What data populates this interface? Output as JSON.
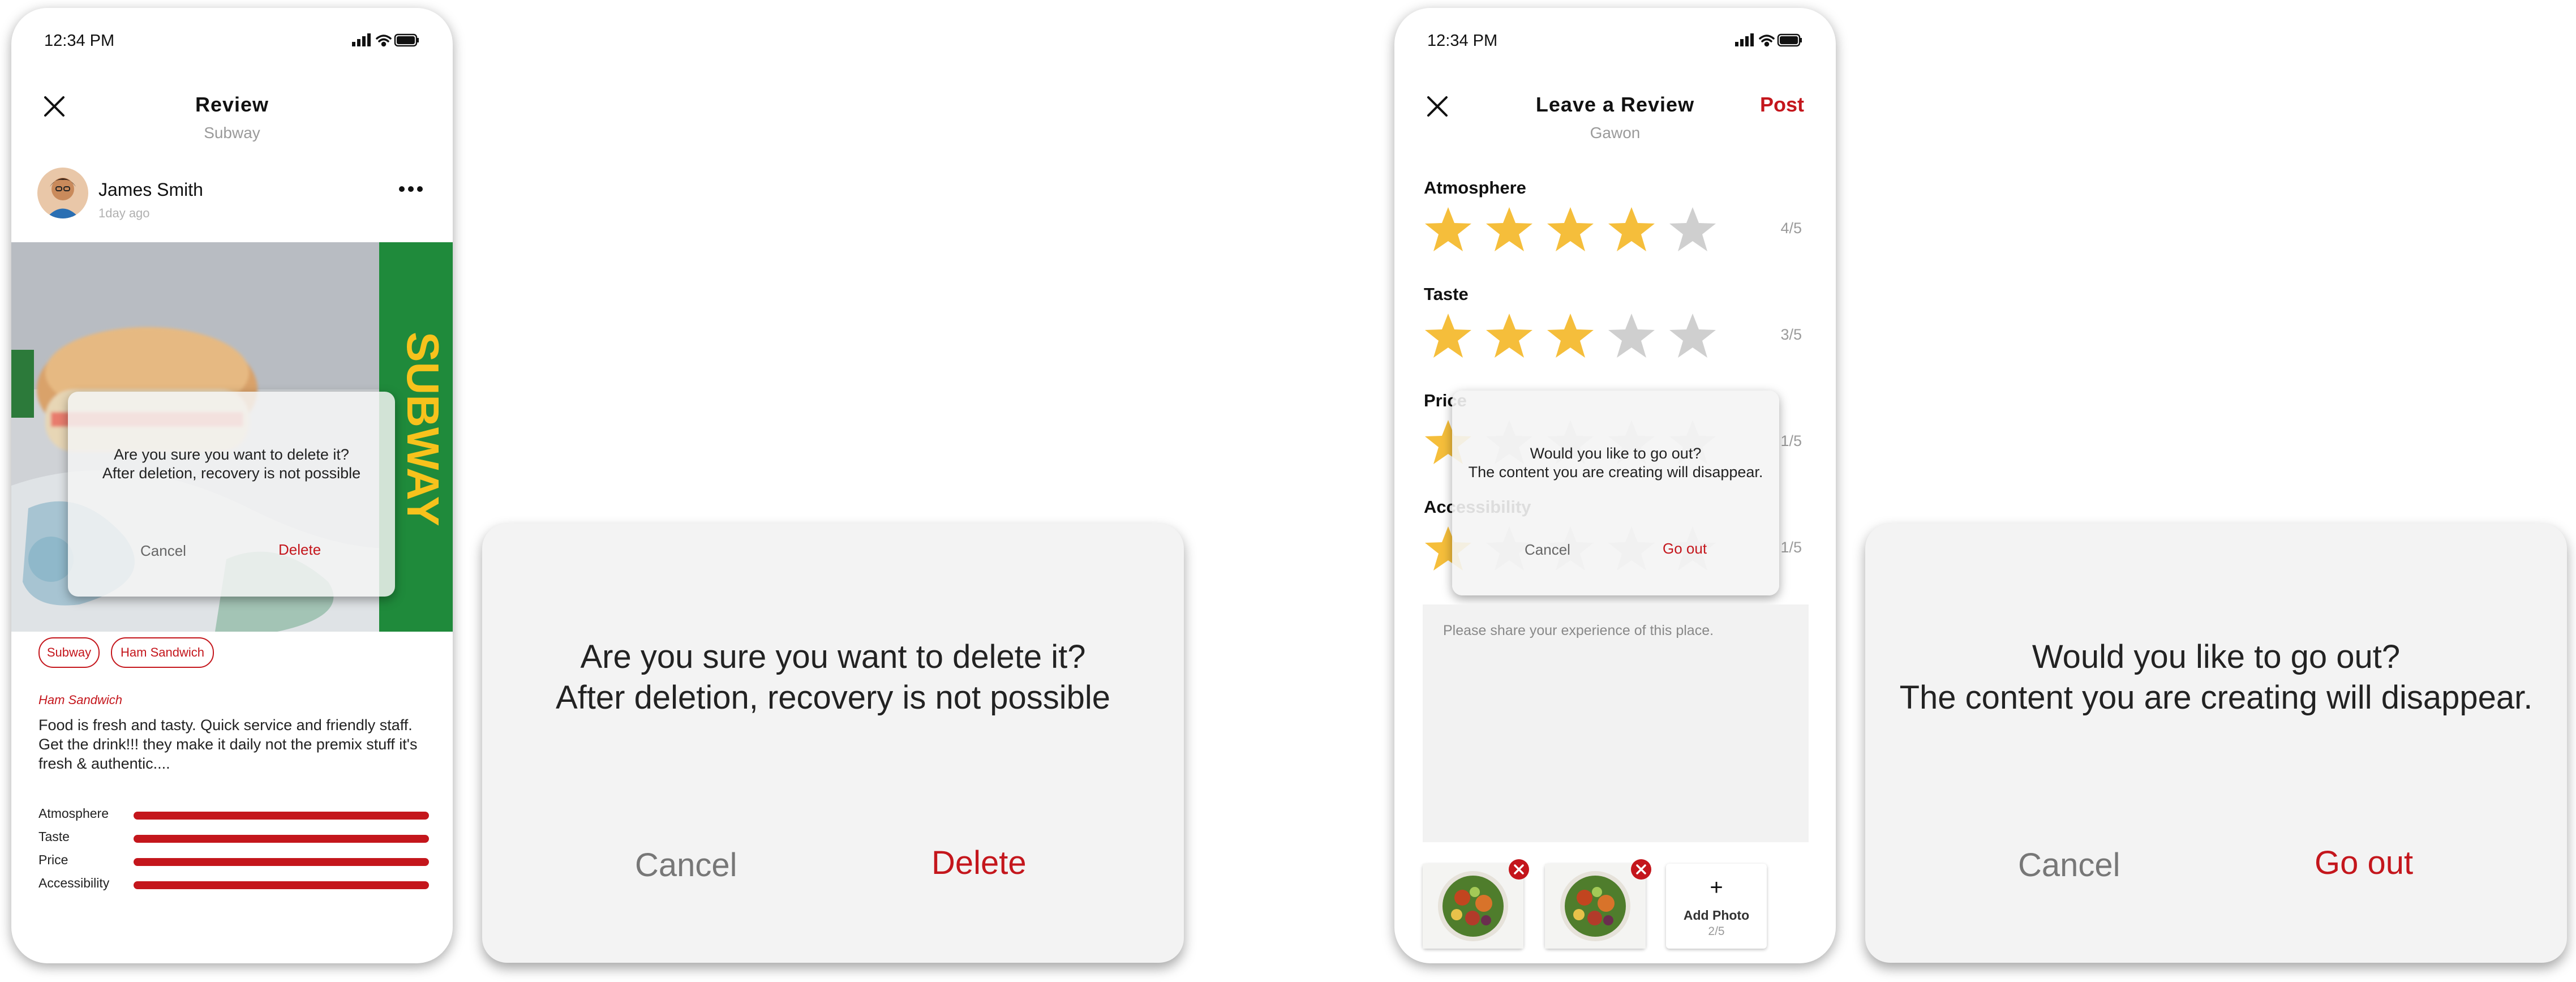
{
  "phone_review": {
    "status_time": "12:34 PM",
    "title": "Review",
    "subtitle": "Subway",
    "user": {
      "name": "James Smith",
      "time": "1day ago"
    },
    "tags": [
      "Subway",
      "Ham Sandwich"
    ],
    "dish": "Ham Sandwich",
    "review_text": "Food is fresh and tasty. Quick service and friendly staff. Get the drink!!! they make it daily not the premix stuff it's fresh & authentic....",
    "metrics": [
      {
        "label": "Atmosphere",
        "value": 1.0
      },
      {
        "label": "Taste",
        "value": 1.0
      },
      {
        "label": "Price",
        "value": 1.0
      },
      {
        "label": "Accessibility",
        "value": 1.0
      }
    ],
    "dialog": {
      "line1": "Are you sure you want to delete it?",
      "line2": "After deletion, recovery is not possible",
      "cancel": "Cancel",
      "confirm": "Delete"
    }
  },
  "large_delete_dialog": {
    "line1": "Are you sure you want to delete it?",
    "line2": "After deletion, recovery is not possible",
    "cancel": "Cancel",
    "confirm": "Delete"
  },
  "phone_leave_review": {
    "status_time": "12:34 PM",
    "title": "Leave a Review",
    "subtitle": "Gawon",
    "post_label": "Post",
    "categories": [
      {
        "label": "Atmosphere",
        "rating": 4,
        "score": "4/5"
      },
      {
        "label": "Taste",
        "rating": 3,
        "score": "3/5"
      },
      {
        "label": "Price",
        "rating": 1,
        "score": "1/5"
      },
      {
        "label": "Accessibility",
        "rating": 1,
        "score": "1/5"
      }
    ],
    "placeholder": "Please share your experience of this place.",
    "add_photo": {
      "label": "Add Photo",
      "count": "2/5"
    },
    "dialog": {
      "line1": "Would you like to go out?",
      "line2": "The content you are creating will disappear.",
      "cancel": "Cancel",
      "confirm": "Go out"
    }
  },
  "large_exit_dialog": {
    "line1": "Would you like to go out?",
    "line2": "The content you are creating will disappear.",
    "cancel": "Cancel",
    "confirm": "Go out"
  },
  "colors": {
    "accent": "#c4161c",
    "star_on": "#f5be3b",
    "star_off": "#cfcfcf",
    "subway_green": "#1f8a3b",
    "subway_yellow": "#f7c21c"
  },
  "icons": [
    "close-icon",
    "more-icon",
    "signal-icon",
    "wifi-icon",
    "battery-icon",
    "star-icon",
    "remove-icon",
    "plus-icon"
  ]
}
